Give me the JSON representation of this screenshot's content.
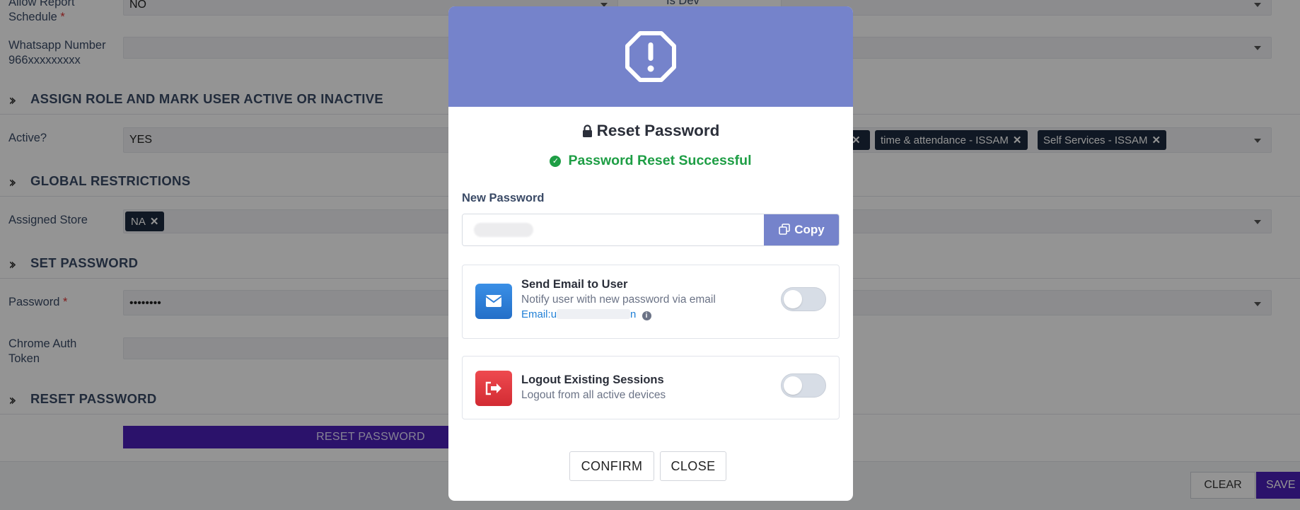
{
  "form": {
    "allow_report_label": "Allow Report Schedule",
    "allow_report_value": "NO",
    "is_dev_label": "Is Dev",
    "whatsapp_label": "Whatsapp Number 966xxxxxxxxx",
    "section_assign": "ASSIGN ROLE AND MARK USER ACTIVE OR INACTIVE",
    "active_label": "Active?",
    "active_value": "YES",
    "role_tags": [
      "time & attendance - ISSAM",
      "Self Services - ISSAM"
    ],
    "section_global": "GLOBAL RESTRICTIONS",
    "store_label": "Assigned Store",
    "store_tag": "NA",
    "section_setpw": "SET PASSWORD",
    "password_label": "Password",
    "password_value": "••••••••",
    "chrome_label": "Chrome Auth Token",
    "section_reset": "RESET PASSWORD",
    "reset_button": "RESET PASSWORD",
    "clear_button": "CLEAR",
    "save_button": "SAVE"
  },
  "modal": {
    "header_icon": "octagon-exclamation-icon",
    "title": "Reset Password",
    "success": "Password Reset Successful",
    "new_password_label": "New Password",
    "copy_label": "Copy",
    "email_option": {
      "title": "Send Email to User",
      "desc": "Notify user with new password via email",
      "email_prefix": "Email:",
      "email_masked": "u",
      "email_suffix": "n",
      "enabled": false
    },
    "logout_option": {
      "title": "Logout Existing Sessions",
      "desc": "Logout from all active devices",
      "enabled": false
    },
    "confirm_label": "CONFIRM",
    "close_label": "CLOSE"
  },
  "colors": {
    "modal_header": "#7583cb",
    "success": "#1e9e45",
    "primary_button": "#4a1fb8",
    "email_icon_bg": "#2e7fd8",
    "logout_icon_bg": "#e0353d"
  }
}
